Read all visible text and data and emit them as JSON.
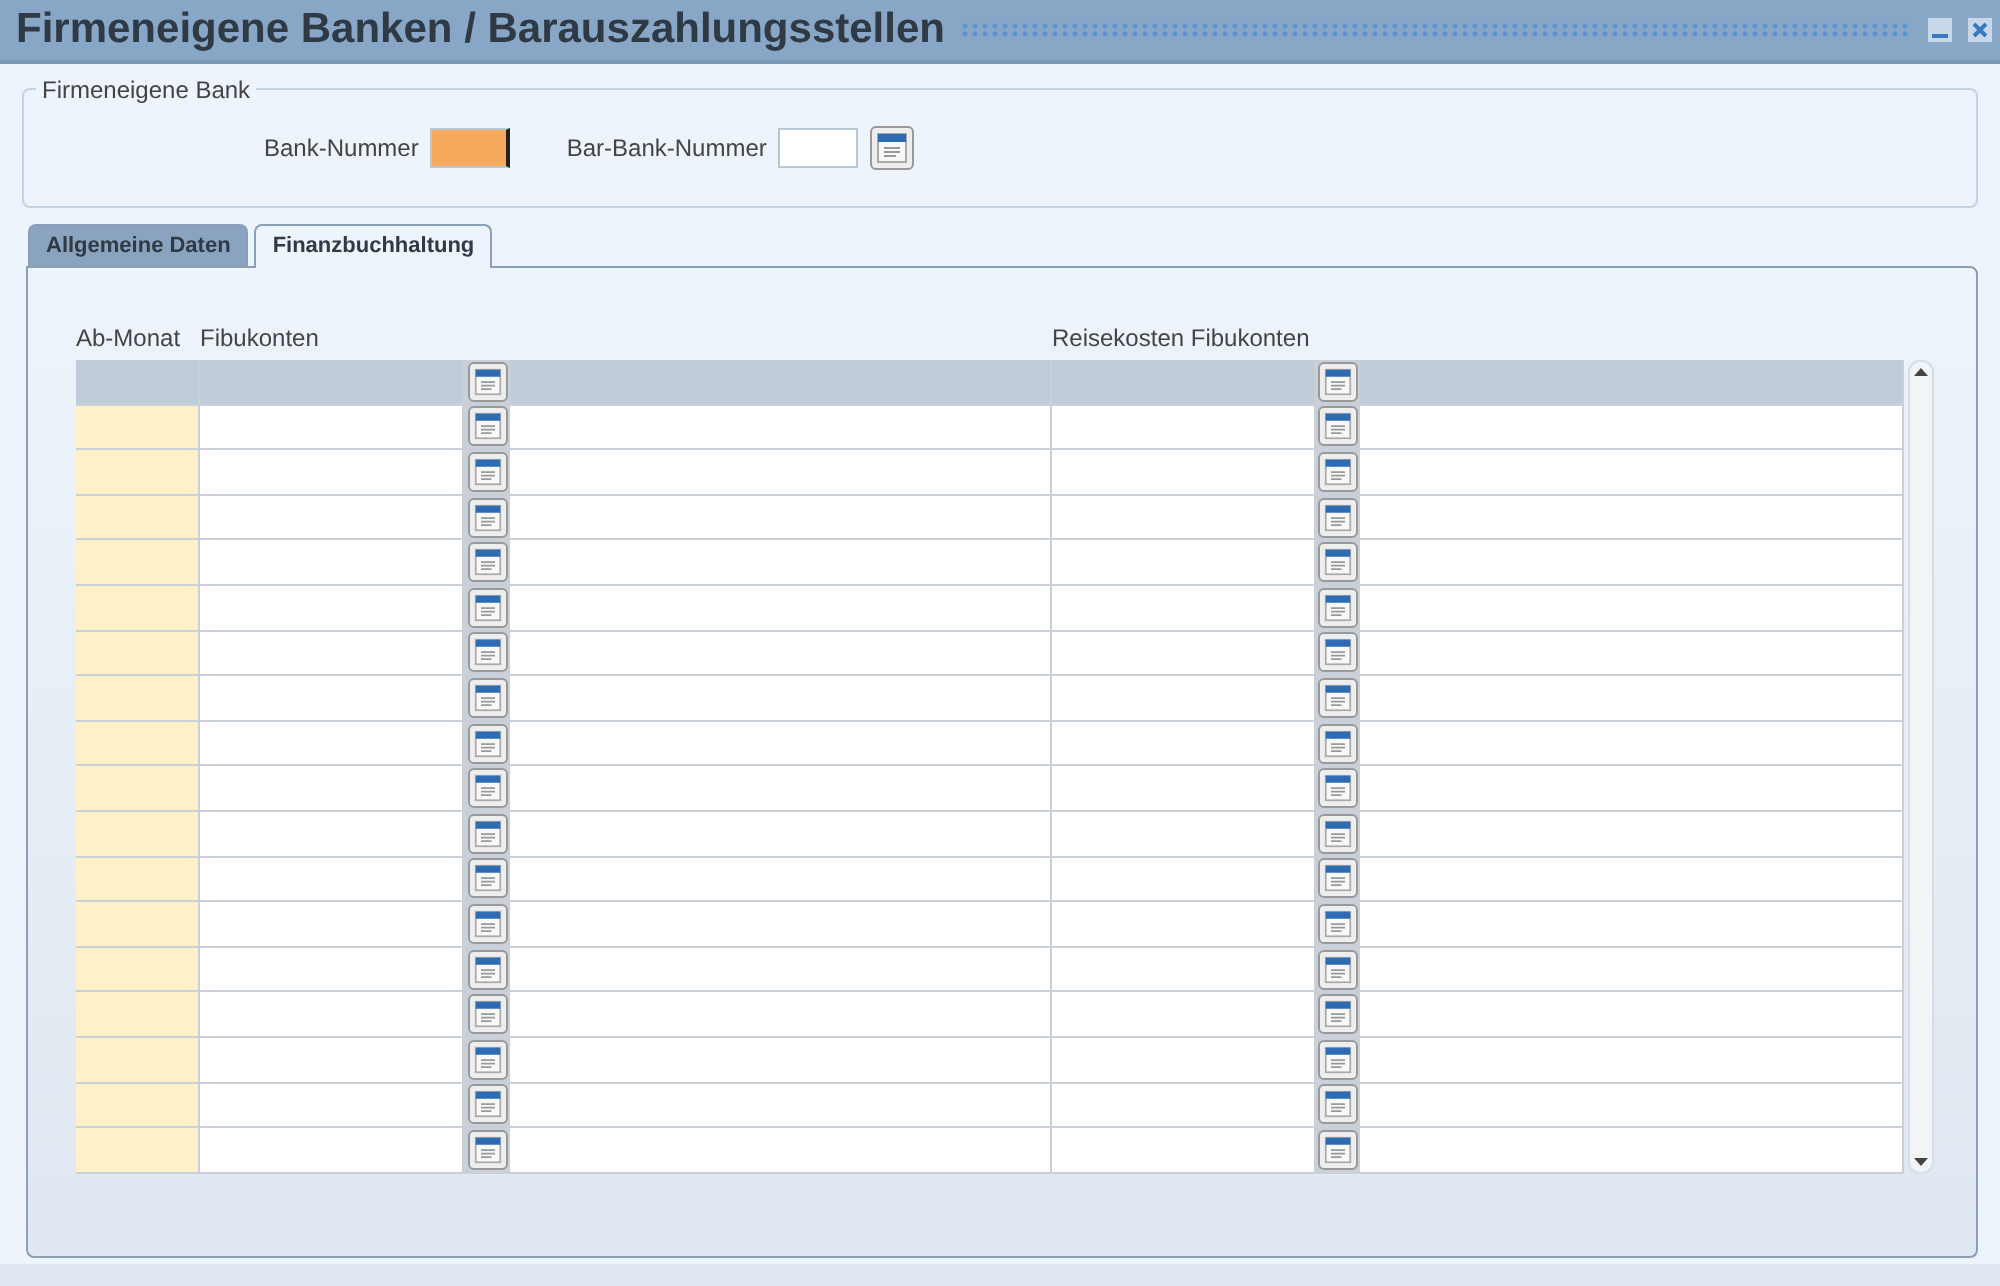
{
  "window": {
    "title": "Firmeneigene Banken / Barauszahlungsstellen",
    "buttons": [
      {
        "kind": "minimize"
      },
      {
        "kind": "close"
      }
    ]
  },
  "group": {
    "legend": "Firmeneigene Bank",
    "fields": [
      {
        "label": "Bank-Nummer",
        "focused": true,
        "lookup": false
      },
      {
        "label": "Bar-Bank-Nummer",
        "focused": false,
        "lookup": true
      }
    ]
  },
  "tabs": [
    {
      "label": "Allgemeine Daten",
      "selected": false
    },
    {
      "label": "Finanzbuchhaltung",
      "selected": true
    }
  ],
  "table": {
    "columns": [
      {
        "label": "Ab-Monat",
        "kind": "month"
      },
      {
        "label": "Fibukonten",
        "kind": "account"
      },
      {
        "label": "Reisekosten Fibukonten",
        "kind": "account"
      }
    ],
    "rows": [
      {
        "selected": true
      },
      {
        "selected": false
      },
      {
        "selected": false
      },
      {
        "selected": false
      },
      {
        "selected": false
      },
      {
        "selected": false
      },
      {
        "selected": false
      },
      {
        "selected": false
      },
      {
        "selected": false
      },
      {
        "selected": false
      },
      {
        "selected": false
      },
      {
        "selected": false
      },
      {
        "selected": false
      },
      {
        "selected": false
      },
      {
        "selected": false
      },
      {
        "selected": false
      },
      {
        "selected": false
      },
      {
        "selected": false
      }
    ]
  }
}
